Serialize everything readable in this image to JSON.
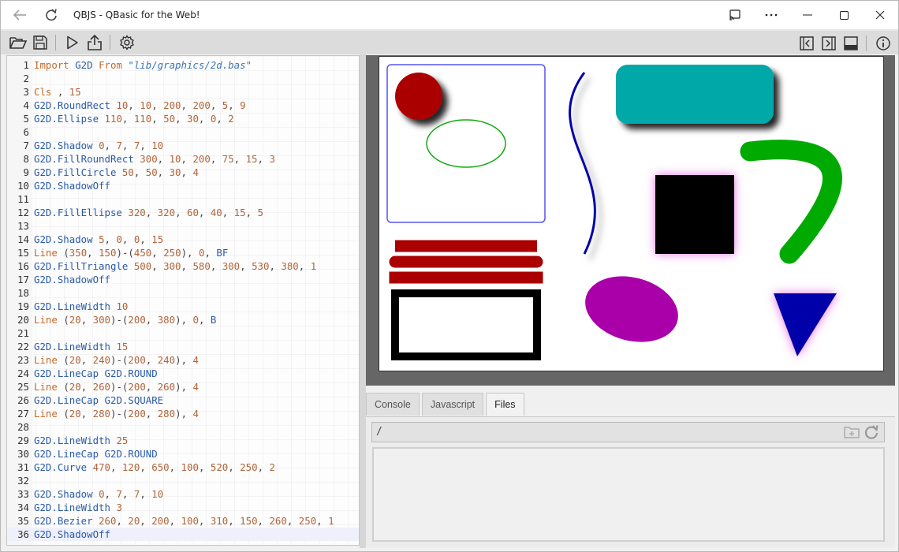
{
  "window": {
    "title": "QBJS - QBasic for the Web!",
    "back_icon": "arrow-left-icon",
    "refresh_icon": "refresh-icon",
    "controls": [
      "cast-icon",
      "more-icon",
      "minimize-icon",
      "maximize-icon",
      "close-icon"
    ]
  },
  "toolbar": {
    "left": [
      "open-folder-icon",
      "save-icon",
      "run-icon",
      "share-icon",
      "settings-icon"
    ],
    "right": [
      "collapse-left-icon",
      "collapse-right-icon",
      "panel-bottom-icon",
      "info-icon"
    ]
  },
  "editor": {
    "lines": [
      {
        "n": "1",
        "tokens": [
          [
            "kw",
            "Import "
          ],
          [
            "fn",
            "G2D "
          ],
          [
            "kw",
            "From "
          ],
          [
            "str",
            "\"lib/graphics/2d.bas\""
          ]
        ]
      },
      {
        "n": "2",
        "tokens": []
      },
      {
        "n": "3",
        "tokens": [
          [
            "kw",
            "Cls "
          ],
          [
            "sym",
            ", "
          ],
          [
            "num",
            "15"
          ]
        ]
      },
      {
        "n": "4",
        "tokens": [
          [
            "fn",
            "G2D.RoundRect "
          ],
          [
            "num",
            "10"
          ],
          [
            "sym",
            ", "
          ],
          [
            "num",
            "10"
          ],
          [
            "sym",
            ", "
          ],
          [
            "num",
            "200"
          ],
          [
            "sym",
            ", "
          ],
          [
            "num",
            "200"
          ],
          [
            "sym",
            ", "
          ],
          [
            "num",
            "5"
          ],
          [
            "sym",
            ", "
          ],
          [
            "num",
            "9"
          ]
        ]
      },
      {
        "n": "5",
        "tokens": [
          [
            "fn",
            "G2D.Ellipse "
          ],
          [
            "num",
            "110"
          ],
          [
            "sym",
            ", "
          ],
          [
            "num",
            "110"
          ],
          [
            "sym",
            ", "
          ],
          [
            "num",
            "50"
          ],
          [
            "sym",
            ", "
          ],
          [
            "num",
            "30"
          ],
          [
            "sym",
            ", "
          ],
          [
            "num",
            "0"
          ],
          [
            "sym",
            ", "
          ],
          [
            "num",
            "2"
          ]
        ]
      },
      {
        "n": "6",
        "tokens": []
      },
      {
        "n": "7",
        "tokens": [
          [
            "fn",
            "G2D.Shadow "
          ],
          [
            "num",
            "0"
          ],
          [
            "sym",
            ", "
          ],
          [
            "num",
            "7"
          ],
          [
            "sym",
            ", "
          ],
          [
            "num",
            "7"
          ],
          [
            "sym",
            ", "
          ],
          [
            "num",
            "10"
          ]
        ]
      },
      {
        "n": "8",
        "tokens": [
          [
            "fn",
            "G2D.FillRoundRect "
          ],
          [
            "num",
            "300"
          ],
          [
            "sym",
            ", "
          ],
          [
            "num",
            "10"
          ],
          [
            "sym",
            ", "
          ],
          [
            "num",
            "200"
          ],
          [
            "sym",
            ", "
          ],
          [
            "num",
            "75"
          ],
          [
            "sym",
            ", "
          ],
          [
            "num",
            "15"
          ],
          [
            "sym",
            ", "
          ],
          [
            "num",
            "3"
          ]
        ]
      },
      {
        "n": "9",
        "tokens": [
          [
            "fn",
            "G2D.FillCircle "
          ],
          [
            "num",
            "50"
          ],
          [
            "sym",
            ", "
          ],
          [
            "num",
            "50"
          ],
          [
            "sym",
            ", "
          ],
          [
            "num",
            "30"
          ],
          [
            "sym",
            ", "
          ],
          [
            "num",
            "4"
          ]
        ]
      },
      {
        "n": "10",
        "tokens": [
          [
            "fn",
            "G2D.ShadowOff"
          ]
        ]
      },
      {
        "n": "11",
        "tokens": []
      },
      {
        "n": "12",
        "tokens": [
          [
            "fn",
            "G2D.FillEllipse "
          ],
          [
            "num",
            "320"
          ],
          [
            "sym",
            ", "
          ],
          [
            "num",
            "320"
          ],
          [
            "sym",
            ", "
          ],
          [
            "num",
            "60"
          ],
          [
            "sym",
            ", "
          ],
          [
            "num",
            "40"
          ],
          [
            "sym",
            ", "
          ],
          [
            "num",
            "15"
          ],
          [
            "sym",
            ", "
          ],
          [
            "num",
            "5"
          ]
        ]
      },
      {
        "n": "13",
        "tokens": []
      },
      {
        "n": "14",
        "tokens": [
          [
            "fn",
            "G2D.Shadow "
          ],
          [
            "num",
            "5"
          ],
          [
            "sym",
            ", "
          ],
          [
            "num",
            "0"
          ],
          [
            "sym",
            ", "
          ],
          [
            "num",
            "0"
          ],
          [
            "sym",
            ", "
          ],
          [
            "num",
            "15"
          ]
        ]
      },
      {
        "n": "15",
        "tokens": [
          [
            "kw",
            "Line "
          ],
          [
            "sym",
            "("
          ],
          [
            "num",
            "350"
          ],
          [
            "sym",
            ", "
          ],
          [
            "num",
            "150"
          ],
          [
            "sym",
            ")-("
          ],
          [
            "num",
            "450"
          ],
          [
            "sym",
            ", "
          ],
          [
            "num",
            "250"
          ],
          [
            "sym",
            "), "
          ],
          [
            "num",
            "0"
          ],
          [
            "sym",
            ", "
          ],
          [
            "fn",
            "BF"
          ]
        ]
      },
      {
        "n": "16",
        "tokens": [
          [
            "fn",
            "G2D.FillTriangle "
          ],
          [
            "num",
            "500"
          ],
          [
            "sym",
            ", "
          ],
          [
            "num",
            "300"
          ],
          [
            "sym",
            ", "
          ],
          [
            "num",
            "580"
          ],
          [
            "sym",
            ", "
          ],
          [
            "num",
            "300"
          ],
          [
            "sym",
            ", "
          ],
          [
            "num",
            "530"
          ],
          [
            "sym",
            ", "
          ],
          [
            "num",
            "380"
          ],
          [
            "sym",
            ", "
          ],
          [
            "num",
            "1"
          ]
        ]
      },
      {
        "n": "17",
        "tokens": [
          [
            "fn",
            "G2D.ShadowOff"
          ]
        ]
      },
      {
        "n": "18",
        "tokens": []
      },
      {
        "n": "19",
        "tokens": [
          [
            "fn",
            "G2D.LineWidth "
          ],
          [
            "num",
            "10"
          ]
        ]
      },
      {
        "n": "20",
        "tokens": [
          [
            "kw",
            "Line "
          ],
          [
            "sym",
            "("
          ],
          [
            "num",
            "20"
          ],
          [
            "sym",
            ", "
          ],
          [
            "num",
            "300"
          ],
          [
            "sym",
            ")-("
          ],
          [
            "num",
            "200"
          ],
          [
            "sym",
            ", "
          ],
          [
            "num",
            "380"
          ],
          [
            "sym",
            "), "
          ],
          [
            "num",
            "0"
          ],
          [
            "sym",
            ", "
          ],
          [
            "fn",
            "B"
          ]
        ]
      },
      {
        "n": "21",
        "tokens": []
      },
      {
        "n": "22",
        "tokens": [
          [
            "fn",
            "G2D.LineWidth "
          ],
          [
            "num",
            "15"
          ]
        ]
      },
      {
        "n": "23",
        "tokens": [
          [
            "kw",
            "Line "
          ],
          [
            "sym",
            "("
          ],
          [
            "num",
            "20"
          ],
          [
            "sym",
            ", "
          ],
          [
            "num",
            "240"
          ],
          [
            "sym",
            ")-("
          ],
          [
            "num",
            "200"
          ],
          [
            "sym",
            ", "
          ],
          [
            "num",
            "240"
          ],
          [
            "sym",
            "), "
          ],
          [
            "num",
            "4"
          ]
        ]
      },
      {
        "n": "24",
        "tokens": [
          [
            "fn",
            "G2D.LineCap "
          ],
          [
            "fn",
            "G2D.ROUND"
          ]
        ]
      },
      {
        "n": "25",
        "tokens": [
          [
            "kw",
            "Line "
          ],
          [
            "sym",
            "("
          ],
          [
            "num",
            "20"
          ],
          [
            "sym",
            ", "
          ],
          [
            "num",
            "260"
          ],
          [
            "sym",
            ")-("
          ],
          [
            "num",
            "200"
          ],
          [
            "sym",
            ", "
          ],
          [
            "num",
            "260"
          ],
          [
            "sym",
            "), "
          ],
          [
            "num",
            "4"
          ]
        ]
      },
      {
        "n": "26",
        "tokens": [
          [
            "fn",
            "G2D.LineCap "
          ],
          [
            "fn",
            "G2D.SQUARE"
          ]
        ]
      },
      {
        "n": "27",
        "tokens": [
          [
            "kw",
            "Line "
          ],
          [
            "sym",
            "("
          ],
          [
            "num",
            "20"
          ],
          [
            "sym",
            ", "
          ],
          [
            "num",
            "280"
          ],
          [
            "sym",
            ")-("
          ],
          [
            "num",
            "200"
          ],
          [
            "sym",
            ", "
          ],
          [
            "num",
            "280"
          ],
          [
            "sym",
            "), "
          ],
          [
            "num",
            "4"
          ]
        ]
      },
      {
        "n": "28",
        "tokens": []
      },
      {
        "n": "29",
        "tokens": [
          [
            "fn",
            "G2D.LineWidth "
          ],
          [
            "num",
            "25"
          ]
        ]
      },
      {
        "n": "30",
        "tokens": [
          [
            "fn",
            "G2D.LineCap "
          ],
          [
            "fn",
            "G2D.ROUND"
          ]
        ]
      },
      {
        "n": "31",
        "tokens": [
          [
            "fn",
            "G2D.Curve "
          ],
          [
            "num",
            "470"
          ],
          [
            "sym",
            ", "
          ],
          [
            "num",
            "120"
          ],
          [
            "sym",
            ", "
          ],
          [
            "num",
            "650"
          ],
          [
            "sym",
            ", "
          ],
          [
            "num",
            "100"
          ],
          [
            "sym",
            ", "
          ],
          [
            "num",
            "520"
          ],
          [
            "sym",
            ", "
          ],
          [
            "num",
            "250"
          ],
          [
            "sym",
            ", "
          ],
          [
            "num",
            "2"
          ]
        ]
      },
      {
        "n": "32",
        "tokens": []
      },
      {
        "n": "33",
        "tokens": [
          [
            "fn",
            "G2D.Shadow "
          ],
          [
            "num",
            "0"
          ],
          [
            "sym",
            ", "
          ],
          [
            "num",
            "7"
          ],
          [
            "sym",
            ", "
          ],
          [
            "num",
            "7"
          ],
          [
            "sym",
            ", "
          ],
          [
            "num",
            "10"
          ]
        ]
      },
      {
        "n": "34",
        "tokens": [
          [
            "fn",
            "G2D.LineWidth "
          ],
          [
            "num",
            "3"
          ]
        ]
      },
      {
        "n": "35",
        "tokens": [
          [
            "fn",
            "G2D.Bezier "
          ],
          [
            "num",
            "260"
          ],
          [
            "sym",
            ", "
          ],
          [
            "num",
            "20"
          ],
          [
            "sym",
            ", "
          ],
          [
            "num",
            "200"
          ],
          [
            "sym",
            ", "
          ],
          [
            "num",
            "100"
          ],
          [
            "sym",
            ", "
          ],
          [
            "num",
            "310"
          ],
          [
            "sym",
            ", "
          ],
          [
            "num",
            "150"
          ],
          [
            "sym",
            ", "
          ],
          [
            "num",
            "260"
          ],
          [
            "sym",
            ", "
          ],
          [
            "num",
            "250"
          ],
          [
            "sym",
            ", "
          ],
          [
            "num",
            "1"
          ]
        ]
      },
      {
        "n": "36",
        "tokens": [
          [
            "fn",
            "G2D.ShadowOff"
          ]
        ]
      }
    ],
    "active_line": 36
  },
  "tabs": [
    {
      "label": "Console",
      "active": false
    },
    {
      "label": "Javascript",
      "active": false
    },
    {
      "label": "Files",
      "active": true
    }
  ],
  "files": {
    "path": "/",
    "new_folder_icon": "new-folder-icon",
    "refresh_icon": "refresh-files-icon"
  },
  "colors": {
    "keyword": "#c26a2a",
    "function": "#2a5aa8",
    "number": "#b0643a",
    "string": "#3b75b8",
    "output_bg": "#666666"
  }
}
